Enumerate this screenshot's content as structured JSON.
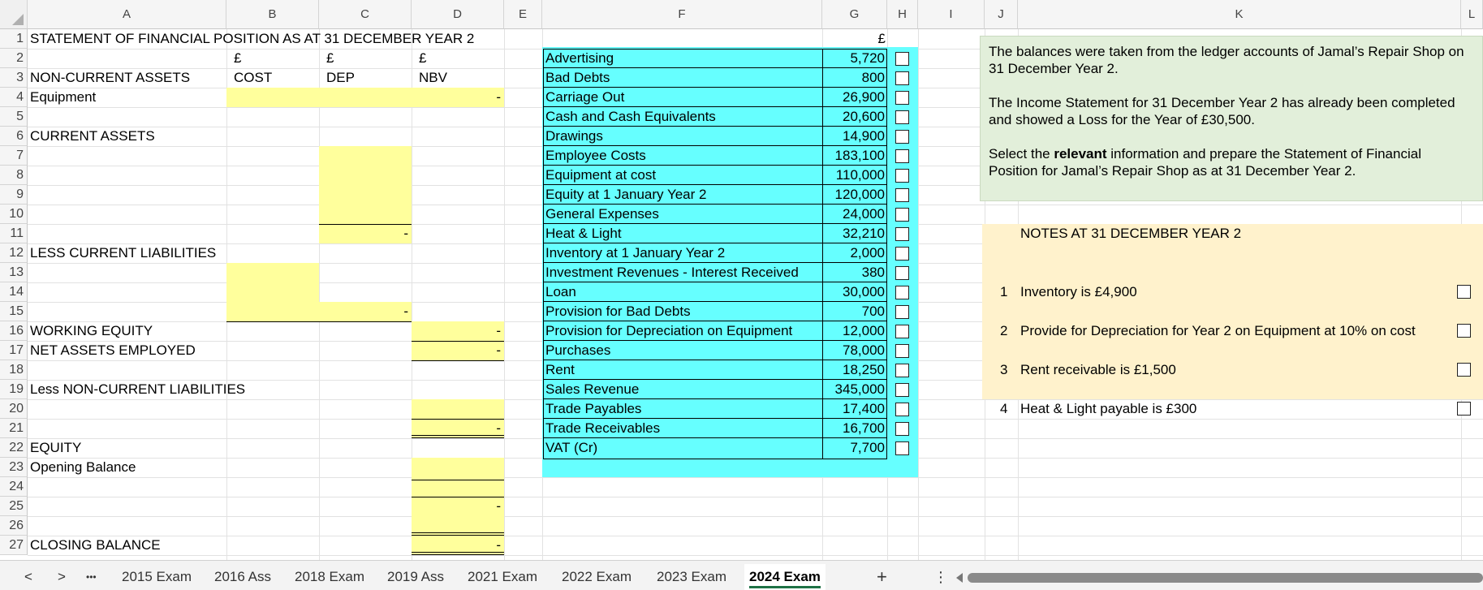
{
  "columns": [
    "A",
    "B",
    "C",
    "D",
    "E",
    "F",
    "G",
    "H",
    "I",
    "J",
    "K",
    "L"
  ],
  "statement": {
    "title": "STATEMENT OF FINANCIAL POSITION AS AT 31 DECEMBER YEAR 2",
    "currency_b": "£",
    "currency_c": "£",
    "currency_d": "£",
    "noncurrent_assets": "NON-CURRENT ASSETS",
    "cost": "COST",
    "dep": "DEP",
    "nbv": "NBV",
    "equipment": "Equipment",
    "current_assets": "CURRENT ASSETS",
    "less_current_liabilities": "LESS CURRENT LIABILITIES",
    "working_equity": "WORKING EQUITY",
    "net_assets_employed": "NET ASSETS EMPLOYED",
    "less_noncurrent_liabilities": "Less NON-CURRENT LIABILITIES",
    "equity": "EQUITY",
    "opening_balance": "Opening Balance",
    "closing_balance": "CLOSING BALANCE",
    "dash": "-"
  },
  "balances": {
    "currency": "£",
    "items": [
      {
        "label": "Advertising",
        "value": "5,720"
      },
      {
        "label": "Bad Debts",
        "value": "800"
      },
      {
        "label": "Carriage Out",
        "value": "26,900"
      },
      {
        "label": "Cash and Cash Equivalents",
        "value": "20,600"
      },
      {
        "label": "Drawings",
        "value": "14,900"
      },
      {
        "label": "Employee Costs",
        "value": "183,100"
      },
      {
        "label": "Equipment at cost",
        "value": "110,000"
      },
      {
        "label": "Equity at 1 January Year 2",
        "value": "120,000"
      },
      {
        "label": "General Expenses",
        "value": "24,000"
      },
      {
        "label": "Heat & Light",
        "value": "32,210"
      },
      {
        "label": "Inventory at 1 January Year 2",
        "value": "2,000"
      },
      {
        "label": "Investment Revenues - Interest Received",
        "value": "380"
      },
      {
        "label": "Loan",
        "value": "30,000"
      },
      {
        "label": "Provision for Bad Debts",
        "value": "700"
      },
      {
        "label": "Provision for Depreciation on Equipment",
        "value": "12,000"
      },
      {
        "label": "Purchases",
        "value": "78,000"
      },
      {
        "label": "Rent",
        "value": "18,250"
      },
      {
        "label": "Sales Revenue",
        "value": "345,000"
      },
      {
        "label": "Trade Payables",
        "value": "17,400"
      },
      {
        "label": "Trade Receivables",
        "value": "16,700"
      },
      {
        "label": "VAT (Cr)",
        "value": "7,700"
      }
    ]
  },
  "instructions": {
    "p1": "The  balances were taken from the ledger accounts of Jamal’s Repair Shop on 31 December Year 2.",
    "p2": "The Income Statement for 31 December Year 2 has already been completed and showed a Loss for the Year of £30,500.",
    "p3_pre": "Select the ",
    "p3_bold": "relevant",
    "p3_post": " information and prepare the Statement of Financial Position for Jamal’s Repair Shop as at 31 December Year 2."
  },
  "notes": {
    "title": "NOTES AT 31 DECEMBER YEAR 2",
    "items": [
      {
        "num": "1",
        "text": "Inventory is £4,900"
      },
      {
        "num": "2",
        "text": "Provide for Depreciation for Year 2 on Equipment at 10% on cost"
      },
      {
        "num": "3",
        "text": "Rent receivable is £1,500"
      },
      {
        "num": "4",
        "text": "Heat & Light payable is £300"
      }
    ]
  },
  "tabs": {
    "items": [
      "2015 Exam",
      "2016 Ass",
      "2018 Exam",
      "2019 Ass",
      "2021 Exam",
      "2022 Exam",
      "2023 Exam",
      "2024 Exam"
    ],
    "active": "2024 Exam",
    "more": "•••",
    "prev": "<",
    "next": ">",
    "add": "+",
    "menu": "⋮"
  }
}
